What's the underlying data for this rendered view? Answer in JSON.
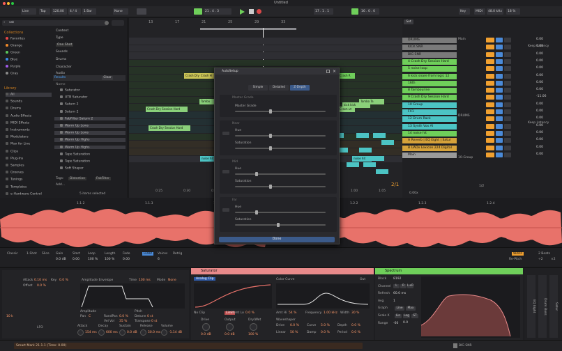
{
  "window": {
    "title": "Untitled"
  },
  "colors": {
    "accent": "#f0a030",
    "green": "#6fcf5a",
    "teal": "#4cc4c4",
    "salmon": "#e88a8a",
    "amber": "#d6a23a",
    "clip_yellow": "#c9c456"
  },
  "transport": {
    "mode": "Live",
    "tap": "Tap",
    "tempo": "120.00",
    "signature": "4 / 4",
    "metro": "1 Bar",
    "follow": "None",
    "position": "21 . 4 . 3",
    "loop_start": "17 . 1 . 1",
    "loop_len": "16 . 0 . 0",
    "key": "Key",
    "midi": "MIDI",
    "sample_rate": "48.0 kHz",
    "cpu": "18 %"
  },
  "browser": {
    "search_value": "sat",
    "collections_label": "Collections",
    "collections": [
      {
        "label": "Favorites",
        "color": "#e84848"
      },
      {
        "label": "Orange",
        "color": "#f08a2a"
      },
      {
        "label": "Green",
        "color": "#5ac85a"
      },
      {
        "label": "Blue",
        "color": "#3a8ae8"
      },
      {
        "label": "Purple",
        "color": "#a05ae8"
      },
      {
        "label": "Gray",
        "color": "#8a8a8a"
      }
    ],
    "library_label": "Library",
    "library": [
      "All",
      "Sounds",
      "Drums",
      "Audio Effects",
      "MIDI Effects",
      "Instruments",
      "Modulators",
      "Max for Live",
      "Clips",
      "Plug-Ins",
      "Samples",
      "Grooves",
      "Tunings",
      "Templates",
      "e-Hardware Control"
    ],
    "filters": [
      "Content",
      "Type",
      "One Shot",
      "Sounds",
      "Drums",
      "Character",
      "Audio",
      "Name"
    ],
    "results_label": "Results",
    "clear": "Clear",
    "results": [
      "Saturator",
      "UTB Saturator",
      "Saturn 2",
      "Saturn 2",
      "FabFilter Saturn 2",
      "Warm Up Lows",
      "Warm Up Lows",
      "Warm Up Highs",
      "Warm Up Highs",
      "Tape Saturation",
      "Tape Saturation",
      "Soft Shaper"
    ],
    "tags_label": "Tags:",
    "tags": [
      "Distortion",
      "FabFilter"
    ],
    "add": "Add...",
    "selected_count": "5 items selected"
  },
  "arrangement": {
    "ruler": [
      "13",
      "17",
      "21",
      "25",
      "29",
      "33"
    ],
    "ruler_b": [
      "0:25",
      "0:30",
      "0:35",
      "0:40",
      "0:45",
      "0:50",
      "0:55",
      "1:00",
      "1:05"
    ],
    "clips": [
      "Crash Dry Session Hard",
      "Crash H",
      "Crash R",
      "Crash Dry Session Hard",
      "Crash Dr",
      "Tambo",
      "Tambo Ta",
      "kick kick",
      "noise hit",
      "noise hit",
      "Crash Dry Session Hard"
    ],
    "sig": "2/1"
  },
  "mixer": {
    "set": "Set",
    "tracks": [
      {
        "name": "DRUMS",
        "color": "#7a7a7a",
        "vol": "0.00"
      },
      {
        "name": "KICK SNR",
        "color": "#7a7a7a",
        "vol": "0.00"
      },
      {
        "name": "BIG SNR",
        "color": "#7a7a7a",
        "vol": "0.00"
      },
      {
        "name": "4 Crash Dry Session Hard",
        "color": "#6fcf5a",
        "vol": "0.00"
      },
      {
        "name": "5 noise loop",
        "color": "#6fcf5a",
        "vol": "0.00"
      },
      {
        "name": "6 kick snare from logic 12",
        "color": "#6fcf5a",
        "vol": "0.00"
      },
      {
        "name": "16th",
        "color": "#6fcf5a",
        "vol": "0.00"
      },
      {
        "name": "8 Tambourine",
        "color": "#6fcf5a",
        "vol": "0.00"
      },
      {
        "name": "9 Crash Dry Session Hard",
        "color": "#6fcf5a",
        "vol": "-11.06"
      },
      {
        "name": "10 Group",
        "color": "#4cc4c4",
        "vol": "0.00"
      },
      {
        "name": "FX1",
        "color": "#4cc4c4",
        "vol": "0.00"
      },
      {
        "name": "12 Drum Rack",
        "color": "#4cc4c4",
        "vol": "0.00"
      },
      {
        "name": "13 Synth Vox AI",
        "color": "#4cc4c4",
        "vol": "0.00"
      },
      {
        "name": "14 noise hit",
        "color": "#6fcf5a",
        "vol": "0.00"
      },
      {
        "name": "A Reverb | EQ Eight | Satur",
        "color": "#d6a23a",
        "vol": "0.00"
      },
      {
        "name": "B UADx Lexicon 224 Digital",
        "color": "#d6a23a",
        "vol": "0.00"
      },
      {
        "name": "Main",
        "color": "#9a9a9a",
        "vol": "0.00"
      }
    ],
    "main_route": "Main",
    "keep_latency": "Keep Latency",
    "drums_route": "DRUMS",
    "group_route": "10-Group",
    "ratio": "1/2",
    "tempo_small": "0.00x"
  },
  "dialog": {
    "title": "AutoSetup",
    "tabs": [
      "Simple",
      "Detailed",
      "Z-Depth"
    ],
    "master_label": "Master Grade",
    "sections": [
      {
        "label": "Near",
        "p1": "Hue",
        "p2": "Saturation",
        "h": 0.38,
        "s": 0.38
      },
      {
        "label": "Mid",
        "p1": "Hue",
        "p2": "Saturation",
        "h": 0.22,
        "s": 0.38
      },
      {
        "label": "Far",
        "p1": "Hue",
        "p2": "Saturation",
        "h": 0.22,
        "s": 0.46
      }
    ],
    "master": 0.38,
    "done": "Done"
  },
  "wave": {
    "markers": [
      "1.1.2",
      "1.1.3",
      "1.1.4",
      "1.2",
      "1.2.2",
      "1.2.3",
      "1.2.4"
    ]
  },
  "clip_props": {
    "labels": [
      "Classic",
      "1-Shot",
      "Slice",
      "Gain",
      "Start",
      "Loop",
      "Length",
      "Fade",
      "LOOP",
      "Voices",
      "Retrig"
    ],
    "values": [
      "0.0 dB",
      "0.00",
      "100 %",
      "100 %",
      "0.00",
      "6"
    ],
    "warp": "WARP",
    "repitch": "Re-Pitch",
    "beats": "2 Beats",
    "half": "÷2",
    "double": "×2"
  },
  "devices": {
    "sampler": {
      "attack": "Attack",
      "attack_v": "0.10 ms",
      "key": "Key",
      "key_v": "0.0 %",
      "offset": "Offset",
      "offset_v": "0.0 %",
      "pitch": "Pitch",
      "pitch_v": "0.0 %",
      "amp_env": "Amplitude Envelope",
      "time": "Time",
      "time_v": "100 ms",
      "mode": "Mode",
      "mode_v": "None",
      "amp": "Amplitude",
      "pitch_chk": "Pitch",
      "pan": "Pan",
      "pan_v": "C",
      "rand": "RandPan",
      "rand_v": "0.0 %",
      "vel": "Vel Vol",
      "vel_v": "35 %",
      "detune": "Detune",
      "detune_v": "0 ct",
      "transp": "Transpose",
      "transp_v": "0 st",
      "lfo": "LFO",
      "a": "Attack",
      "a_v": "154 ms",
      "d": "Decay",
      "d_v": "600 ms",
      "s": "Sustain",
      "s_v": "0.0 dB",
      "r": "Release",
      "r_v": "50.0 ms",
      "volume": "Volume",
      "volume_v": "-1.14 dB",
      "filter_v": "10 k"
    },
    "saturator": {
      "title": "Saturator",
      "mode": "Analog Clip",
      "color_lbl": "Color Curve",
      "out": "Out",
      "no_clip": "No Clip",
      "limit": "Limit",
      "amt_lo": "Amt Lo",
      "amt_lo_v": "0.0 %",
      "amt_hi": "Amt Hi",
      "amt_hi_v": "54 %",
      "freq": "Frequency",
      "freq_v": "1.00 kHz",
      "width": "Width",
      "width_v": "30 %",
      "drive": "Drive",
      "drive_v": "0.0 dB",
      "output": "Output",
      "output_v": "0.0 dB",
      "drywet": "Dry/Wet",
      "drywet_v": "100 %",
      "waveshaper": "Waveshaper",
      "drv": "Drive",
      "drv_v": "0.0 %",
      "curve": "Curve",
      "curve_v": "5.0 %",
      "depth": "Depth",
      "depth_v": "0.0 %",
      "lin": "Linear",
      "lin_v": "50 %",
      "damp": "Damp",
      "damp_v": "0.0 %",
      "period": "Period",
      "period_v": "0.0 %"
    },
    "spectrum": {
      "title": "Spectrum",
      "block": "Block",
      "block_v": "8192",
      "channel": "Channel",
      "lr": "L",
      "r": "R",
      "lplusr": "L+R",
      "refresh": "Refresh",
      "refresh_v": "60.0 ms",
      "avg": "Avg",
      "avg_v": "1",
      "graph": "Graph",
      "line": "Line",
      "max": "Max",
      "scale_x": "Scale X",
      "lin": "Lin",
      "log": "Log",
      "st": "ST",
      "range": "Range",
      "range_v": "-60",
      "range_v2": "0.0",
      "eq_label": "EQ Eight",
      "drum_buss": "Drum Buss",
      "sat_label": "Satur"
    }
  },
  "status": {
    "message": "Smart Mark 21.1.1 (Time: 0.00)",
    "track": "BIG SNR"
  }
}
